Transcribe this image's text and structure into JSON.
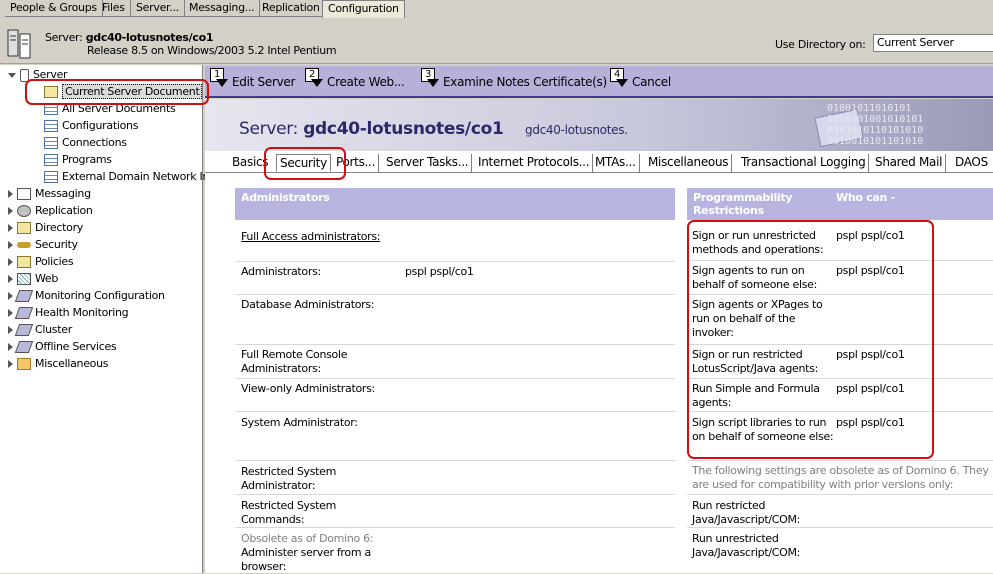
{
  "top_tabs": [
    "People & Groups",
    "Files",
    "Server...",
    "Messaging...",
    "Replication",
    "Configuration"
  ],
  "server_header": {
    "label": "Server:",
    "name": "gdc40-lotusnotes/co1",
    "release": "Release 8.5 on Windows/2003 5.2 Intel Pentium",
    "use_directory_label": "Use Directory on:",
    "use_directory_value": "Current Server"
  },
  "tree": {
    "root": "Server",
    "server_children": [
      "Current Server Document",
      "All Server Documents",
      "Configurations",
      "Connections",
      "Programs",
      "External Domain Network Inf"
    ],
    "groups": [
      "Messaging",
      "Replication",
      "Directory",
      "Security",
      "Policies",
      "Web",
      "Monitoring Configuration",
      "Health Monitoring",
      "Cluster",
      "Offline Services",
      "Miscellaneous"
    ]
  },
  "toolbar": {
    "edit": {
      "num": "1",
      "label": "Edit Server"
    },
    "create_web": {
      "num": "2",
      "label": "Create Web..."
    },
    "examine": {
      "num": "3",
      "label": "Examine Notes Certificate(s)"
    },
    "cancel": {
      "num": "4",
      "label": "Cancel"
    }
  },
  "banner": {
    "prefix": "Server:",
    "name": "gdc40-lotusnotes/co1",
    "sub": "gdc40-lotusnotes."
  },
  "doc_tabs": [
    "Basics",
    "Security",
    "Ports...",
    "Server Tasks...",
    "Internet Protocols...",
    "MTAs...",
    "Miscellaneous",
    "Transactional Logging",
    "Shared Mail",
    "DAOS"
  ],
  "admins": {
    "section_title": "Administrators",
    "full_access": "Full Access administrators:",
    "administrators": "Administrators:",
    "administrators_value": "pspl pspl/co1",
    "db_admins": "Database Administrators:",
    "full_remote": "Full Remote Console Administrators:",
    "view_only": "View-only Administrators:",
    "system_admin": "System Administrator:",
    "restricted_sys_admin": "Restricted System Administrator:",
    "restricted_sys_cmds": "Restricted System Commands:",
    "obsolete": "Obsolete as of Domino 6:",
    "admin_browser": "Administer server from a browser:"
  },
  "prog": {
    "section_title": "Programmability Restrictions",
    "who_can": "Who can -",
    "rows": [
      {
        "label": "Sign or run unrestricted methods and operations:",
        "value": "pspl pspl/co1"
      },
      {
        "label": "Sign agents to run on behalf of someone else:",
        "value": "pspl pspl/co1"
      },
      {
        "label": "Sign agents or XPages to run on behalf of the invoker:",
        "value": ""
      },
      {
        "label": "Sign or run restricted LotusScript/Java agents:",
        "value": "pspl pspl/co1"
      },
      {
        "label": "Run Simple and Formula agents:",
        "value": "pspl pspl/co1"
      },
      {
        "label": "Sign script libraries to run on behalf of someone else:",
        "value": "pspl pspl/co1"
      }
    ],
    "obsolete_note": "The following settings are obsolete as of Domino 6. They are used for compatibility with prior versions only:",
    "run_restricted": "Run restricted Java/Javascript/COM:",
    "run_unrestricted": "Run unrestricted Java/Javascript/COM:"
  }
}
